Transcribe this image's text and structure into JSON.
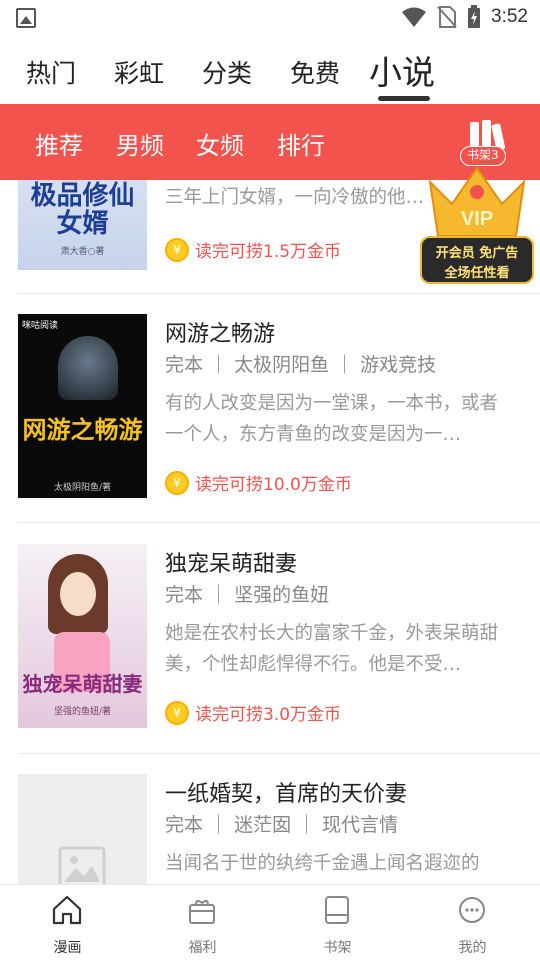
{
  "status_bar": {
    "time": "3:52"
  },
  "top_tabs": [
    {
      "label": "热门"
    },
    {
      "label": "彩虹"
    },
    {
      "label": "分类"
    },
    {
      "label": "免费"
    },
    {
      "label": "小说",
      "active": true
    }
  ],
  "sub_tabs": [
    {
      "label": "推荐"
    },
    {
      "label": "男频"
    },
    {
      "label": "女频"
    },
    {
      "label": "排行"
    }
  ],
  "shelf": {
    "badge": "书架3"
  },
  "vip": {
    "line1": "开会员 免广告",
    "line2": "全场任性看",
    "text": "VIP"
  },
  "books": [
    {
      "title": "",
      "meta": "",
      "desc": "三年上门女婿，一向冷傲的他…",
      "reward": "读完可捞1.5万金币",
      "cover_text": "极品修仙女婿",
      "cover_author": "肃大香○著"
    },
    {
      "title": "网游之畅游",
      "meta": "完本 ｜ 太极阴阳鱼 ｜ 游戏竞技",
      "desc": "有的人改变是因为一堂课，一本书，或者一个人，东方青鱼的改变是因为一…",
      "reward": "读完可捞10.0万金币",
      "cover_text": "网游之畅游",
      "cover_author": "太极阴阳鱼/著",
      "cover_brand": "咪咕阅读"
    },
    {
      "title": "独宠呆萌甜妻",
      "meta": "完本 ｜ 坚强的鱼妞",
      "desc": "她是在农村长大的富家千金，外表呆萌甜美，个性却彪悍得不行。他是不受…",
      "reward": "读完可捞3.0万金币",
      "cover_text": "独宠呆萌甜妻",
      "cover_author": "坚强的鱼妞/著"
    },
    {
      "title": "一纸婚契，首席的天价妻",
      "meta": "完本 ｜ 迷茫囡 ｜ 现代言情",
      "desc": "当闻名于世的纨绔千金遇上闻名遐迩的"
    }
  ],
  "bottom_nav": [
    {
      "label": "漫画",
      "icon": "home-icon",
      "active": true
    },
    {
      "label": "福利",
      "icon": "gift-icon"
    },
    {
      "label": "书架",
      "icon": "bookshelf-icon"
    },
    {
      "label": "我的",
      "icon": "profile-icon"
    }
  ],
  "colors": {
    "accent": "#f2534d",
    "coin": "#ffcc22",
    "vip_gold": "#f0b732"
  }
}
